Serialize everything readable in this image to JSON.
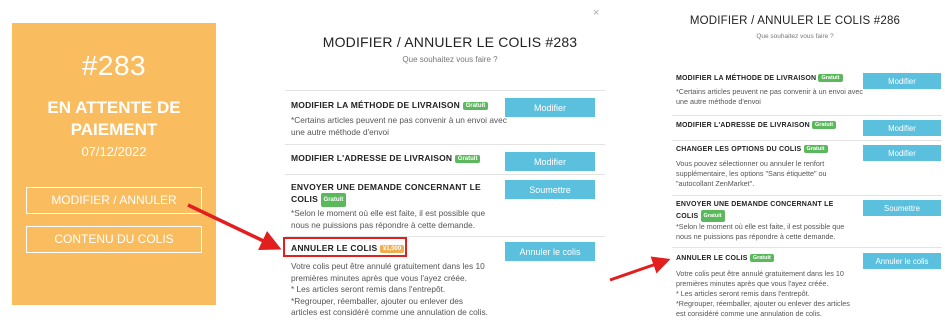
{
  "order_card": {
    "number": "#283",
    "status": "EN ATTENTE DE PAIEMENT",
    "date": "07/12/2022",
    "btn_modify": "MODIFIER / ANNULER",
    "btn_contents": "CONTENU DU COLIS"
  },
  "modal_283": {
    "title": "MODIFIER / ANNULER LE COLIS #283",
    "subtitle": "Que souhaitez vous faire ?",
    "close": "×",
    "options": [
      {
        "title": "MODIFIER LA MÉTHODE DE LIVRAISON",
        "badge": "Gratuit",
        "desc": "*Certains articles peuvent ne pas convenir à un envoi avec une autre méthode d'envoi",
        "button": "Modifier"
      },
      {
        "title": "MODIFIER L'ADRESSE DE LIVRAISON",
        "badge": "Gratuit",
        "desc": "",
        "button": "Modifier"
      },
      {
        "title": "ENVOYER UNE DEMANDE CONCERNANT LE COLIS",
        "badge": "Gratuit",
        "desc": "*Selon le moment où elle est faite, il est possible que nous ne puissions pas répondre à cette demande.",
        "button": "Soumettre"
      },
      {
        "title": "ANNULER LE COLIS",
        "badge": "¥1,000",
        "badge_color": "#f0ad4e",
        "desc_lines": [
          "Votre colis peut être annulé gratuitement dans les 10 premières minutes après que vous l'ayez créée.",
          "* Les articles seront remis dans l'entrepôt.",
          "*Regrouper, réemballer, ajouter ou enlever des articles est considéré comme une annulation de colis."
        ],
        "button": "Annuler le colis"
      }
    ]
  },
  "modal_286": {
    "title": "MODIFIER / ANNULER LE COLIS #286",
    "subtitle": "Que souhaitez vous faire ?",
    "options": [
      {
        "title": "MODIFIER LA MÉTHODE DE LIVRAISON",
        "badge": "Gratuit",
        "desc": "*Certains articles peuvent ne pas convenir à un envoi avec une autre méthode d'envoi",
        "button": "Modifier"
      },
      {
        "title": "MODIFIER L'ADRESSE DE LIVRAISON",
        "badge": "Gratuit",
        "desc": "",
        "button": "Modifier"
      },
      {
        "title": "CHANGER LES OPTIONS DU COLIS",
        "badge": "Gratuit",
        "desc": "Vous pouvez sélectionner ou annuler le renfort supplémentaire, les options \"Sans étiquette\" ou \"autocollant ZenMarket\".",
        "button": "Modifier"
      },
      {
        "title": "ENVOYER UNE DEMANDE CONCERNANT LE COLIS",
        "badge": "Gratuit",
        "desc": "*Selon le moment où elle est faite, il est possible que nous ne puissions pas répondre à cette demande.",
        "button": "Soumettre"
      },
      {
        "title": "ANNULER LE COLIS",
        "badge": "Gratuit",
        "desc_lines": [
          "Votre colis peut être annulé gratuitement dans les 10 premières minutes après que vous l'ayez créée.",
          "* Les articles seront remis dans l'entrepôt.",
          "*Regrouper, réemballer, ajouter ou enlever des articles est considéré comme une annulation de colis."
        ],
        "button": "Annuler le colis"
      }
    ]
  },
  "colors": {
    "card_orange": "#f9bc5e",
    "button_blue": "#5bc0de",
    "badge_green": "#5cb85c",
    "badge_orange": "#f0ad4e",
    "highlight_red": "#e21f1f"
  }
}
